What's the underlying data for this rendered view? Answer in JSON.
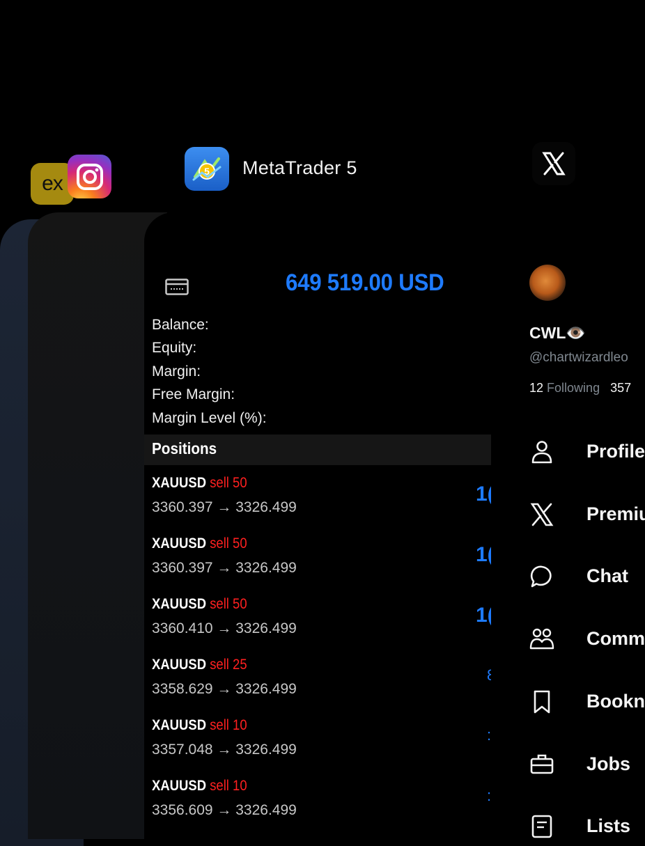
{
  "app_switcher": {
    "apps": [
      {
        "name": "Exness",
        "icon": "exness-icon",
        "icon_text": "ex"
      },
      {
        "name": "Instagram",
        "icon": "instagram-icon"
      },
      {
        "name": "MetaTrader 5",
        "icon": "metatrader5-icon",
        "title": "MetaTrader 5"
      },
      {
        "name": "X",
        "icon": "x-logo-icon"
      }
    ]
  },
  "metatrader": {
    "balance_value": "649 519.00 USD",
    "account_labels": [
      "Balance:",
      "Equity:",
      "Margin:",
      "Free Margin:",
      "Margin Level (%):"
    ],
    "positions_title": "Positions",
    "positions": [
      {
        "symbol": "XAUUSD",
        "side": "sell 50",
        "prices": "3360.397 → 3326.499",
        "profit_partial": "1("
      },
      {
        "symbol": "XAUUSD",
        "side": "sell 50",
        "prices": "3360.397 → 3326.499",
        "profit_partial": "1("
      },
      {
        "symbol": "XAUUSD",
        "side": "sell 50",
        "prices": "3360.410 → 3326.499",
        "profit_partial": "1("
      },
      {
        "symbol": "XAUUSD",
        "side": "sell 25",
        "prices": "3358.629 → 3326.499",
        "profit_partial": "8"
      },
      {
        "symbol": "XAUUSD",
        "side": "sell 10",
        "prices": "3357.048 → 3326.499",
        "profit_partial": ":"
      },
      {
        "symbol": "XAUUSD",
        "side": "sell 10",
        "prices": "3356.609 → 3326.499",
        "profit_partial": ":"
      }
    ],
    "colors": {
      "accent": "#1e7bff",
      "sell": "#ff2020"
    }
  },
  "x_app": {
    "profile": {
      "name": "CWL",
      "name_emoji": "👁️",
      "handle": "@chartwizardleo",
      "following_count": "12",
      "following_label": "Following",
      "followers_count": "357"
    },
    "menu": [
      {
        "label": "Profile",
        "icon": "person-icon"
      },
      {
        "label": "Premiu",
        "icon": "x-logo-icon"
      },
      {
        "label": "Chat",
        "icon": "chat-bubble-icon"
      },
      {
        "label": "Comm",
        "icon": "communities-icon"
      },
      {
        "label": "Bookn",
        "icon": "bookmark-icon"
      },
      {
        "label": "Jobs",
        "icon": "briefcase-icon"
      },
      {
        "label": "Lists",
        "icon": "list-icon"
      }
    ]
  }
}
